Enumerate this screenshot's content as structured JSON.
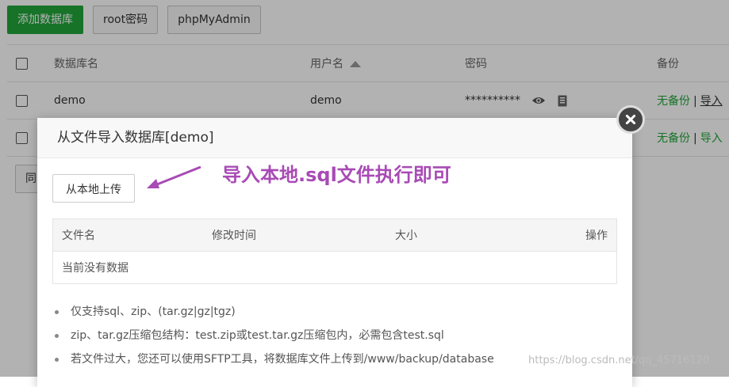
{
  "toolbar": {
    "add_db": "添加数据库",
    "root_pwd": "root密码",
    "phpmyadmin": "phpMyAdmin"
  },
  "table": {
    "headers": {
      "name": "数据库名",
      "user": "用户名",
      "password": "密码",
      "backup": "备份"
    },
    "rows": [
      {
        "name": "demo",
        "user": "demo",
        "password": "**********",
        "backup_status": "无备份",
        "import": "导入"
      },
      {
        "backup_status": "无备份",
        "import": "导入"
      }
    ],
    "bottom_btn_partial": "同"
  },
  "modal": {
    "title": "从文件导入数据库[demo]",
    "upload_btn": "从本地上传",
    "annotation": "导入本地.sql文件执行即可",
    "file_table": {
      "headers": {
        "filename": "文件名",
        "mtime": "修改时间",
        "size": "大小",
        "ops": "操作"
      },
      "empty": "当前没有数据"
    },
    "tips": [
      "仅支持sql、zip、(tar.gz|gz|tgz)",
      "zip、tar.gz压缩包结构：test.zip或test.tar.gz压缩包内，必需包含test.sql",
      "若文件过大，您还可以使用SFTP工具，将数据库文件上传到/www/backup/database"
    ]
  },
  "watermark": "https://blog.csdn.net/qq_45716120",
  "colors": {
    "brand_green": "#20a53a",
    "annotation_purple": "#a84bb5"
  }
}
